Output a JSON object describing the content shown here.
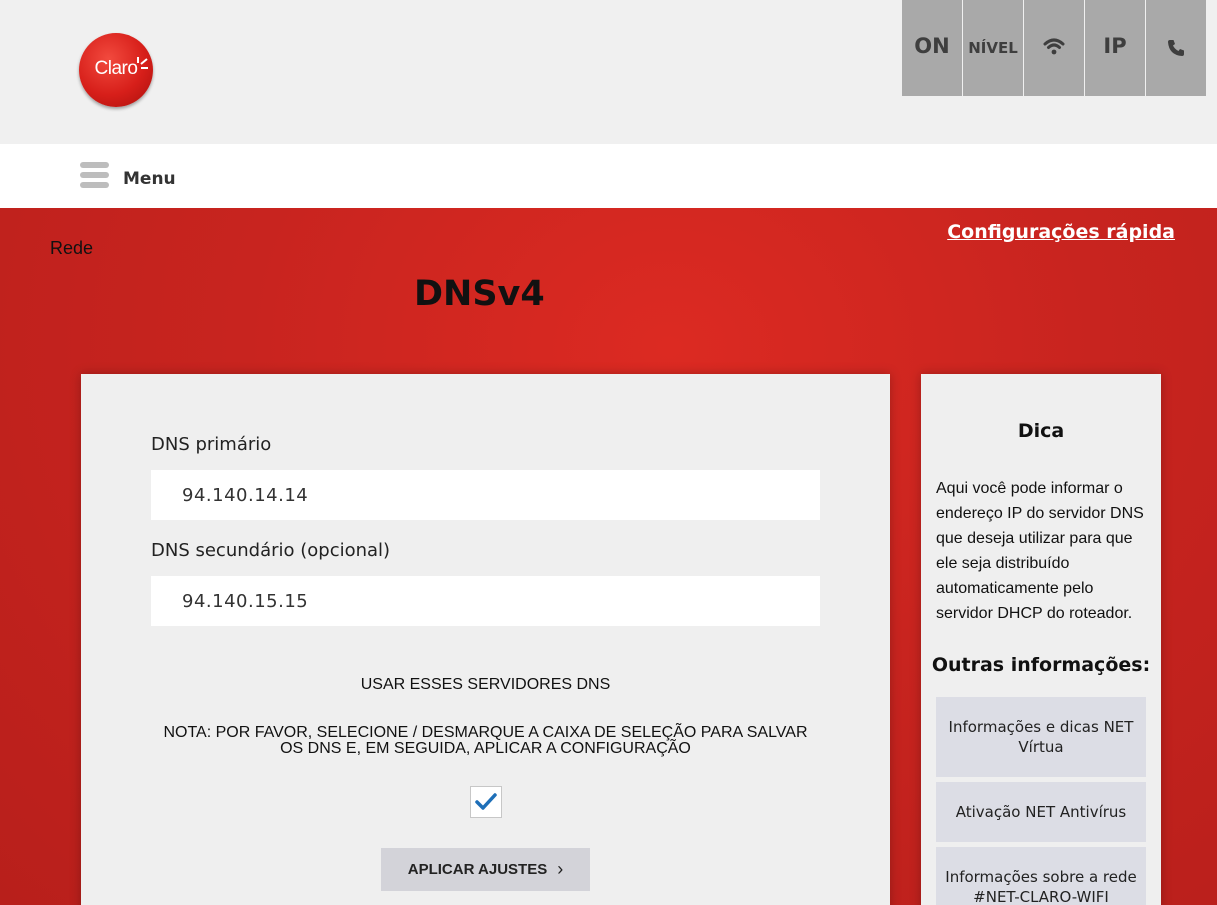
{
  "header": {
    "logo_text": "Claro",
    "status": [
      {
        "label": "ON",
        "icon": "status-on-icon"
      },
      {
        "label": "NÍVEL",
        "icon": "signal-level-icon"
      },
      {
        "label": "",
        "icon": "wifi-icon"
      },
      {
        "label": "IP",
        "icon": "ip-icon"
      },
      {
        "label": "",
        "icon": "phone-icon"
      }
    ]
  },
  "menu": {
    "label": "Menu"
  },
  "breadcrumb": "Rede",
  "quick_link": "Configurações rápida",
  "page_title": "DNSv4",
  "form": {
    "primary_label": "DNS primário",
    "primary_value": "94.140.14.14",
    "secondary_label": "DNS secundário (opcional)",
    "secondary_value": "94.140.15.15",
    "use_servers_text": "USAR ESSES SERVIDORES DNS",
    "note": "NOTA: POR FAVOR, SELECIONE / DESMARQUE A CAIXA DE SELEÇÃO PARA SALVAR OS DNS E, EM SEGUIDA, APLICAR A CONFIGURAÇÃO",
    "checkbox_checked": true,
    "apply_label": "APLICAR AJUSTES"
  },
  "tip": {
    "title": "Dica",
    "body": "Aqui você pode informar o endereço IP do servidor DNS que deseja utilizar para que ele seja distribuído automaticamente pelo servidor DHCP do roteador.",
    "other_title": "Outras informações:",
    "links": [
      "Informações e dicas NET Vírtua",
      "Ativação NET Antivírus",
      "Informações sobre a rede #NET-CLARO-WIFI"
    ]
  },
  "colors": {
    "brand_red": "#c8241f",
    "checkmark": "#1e6fb8",
    "status_bg": "#a9a9a9"
  }
}
